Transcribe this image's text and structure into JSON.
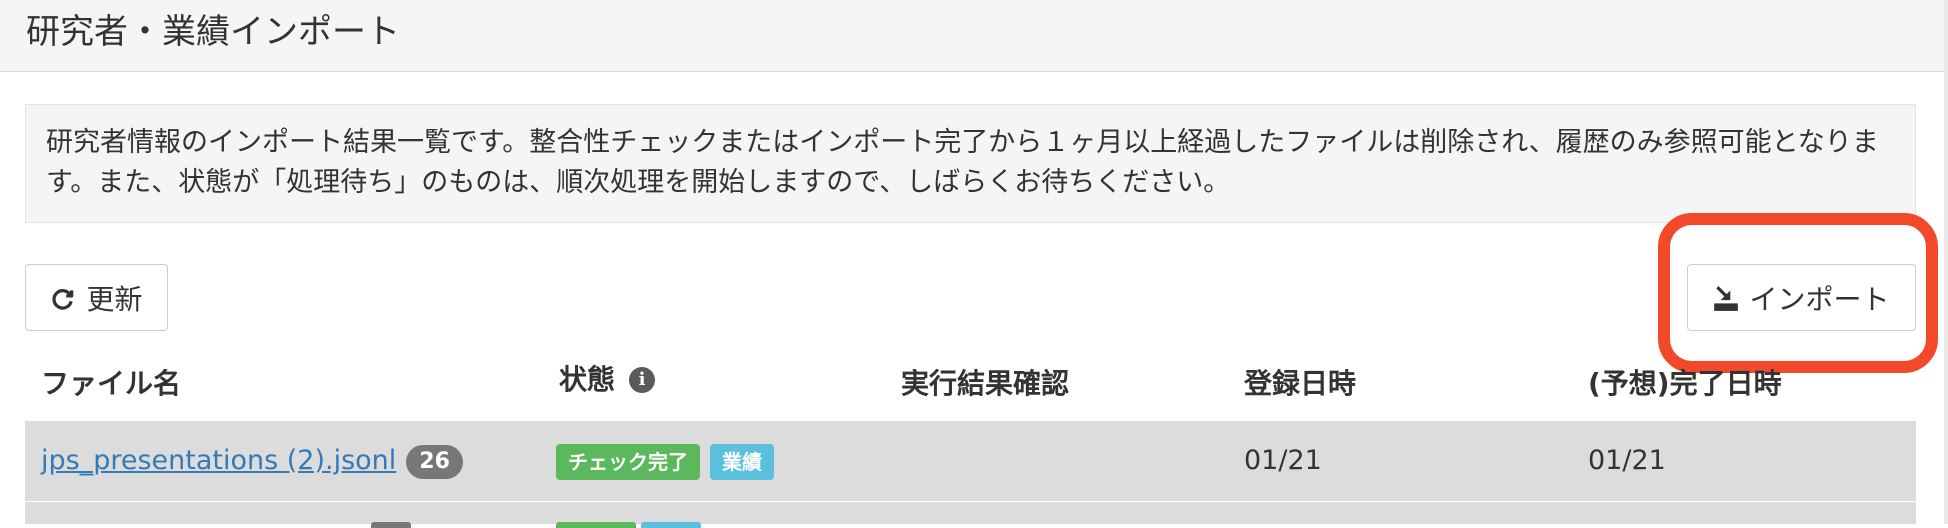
{
  "page": {
    "title": "研究者・業績インポート"
  },
  "notice": {
    "text": "研究者情報のインポート結果一覧です。整合性チェックまたはインポート完了から１ヶ月以上経過したファイルは削除され、履歴のみ参照可能となります。また、状態が「処理待ち」のものは、順次処理を開始しますので、しばらくお待ちください。"
  },
  "toolbar": {
    "refresh_label": "更新",
    "refresh_icon": "refresh-icon",
    "import_label": "インポート",
    "import_icon": "import-icon"
  },
  "highlight": {
    "color": "#f1492a"
  },
  "table": {
    "columns": {
      "filename": "ファイル名",
      "status": "状態",
      "status_info_icon": "info-icon",
      "result": "実行結果確認",
      "registered": "登録日時",
      "completed": "(予想)完了日時"
    },
    "rows": [
      {
        "filename": "jps_presentations (2).jsonl",
        "count": "26",
        "status": "チェック完了",
        "type": "業績",
        "result": "",
        "registered": "01/21",
        "completed": "01/21"
      }
    ]
  },
  "colors": {
    "link": "#337ab7",
    "success": "#5cb85c",
    "info": "#5bc0de",
    "row_bg": "#dcdcdc"
  }
}
